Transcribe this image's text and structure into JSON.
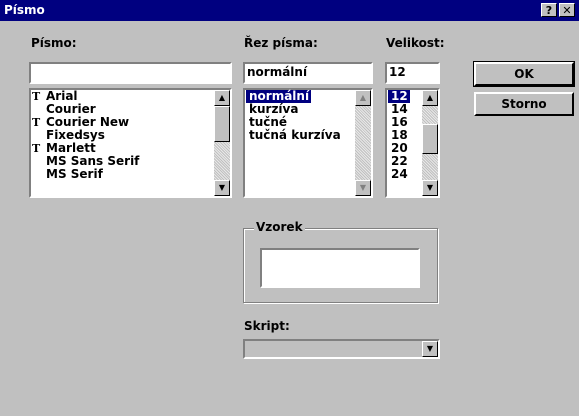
{
  "window": {
    "title": "Písmo",
    "help_label": "?",
    "close_label": "✕"
  },
  "font": {
    "label": "Písmo:",
    "value": "",
    "items": [
      {
        "name": "Arial",
        "truetype": true,
        "selected": false
      },
      {
        "name": "Courier",
        "truetype": false,
        "selected": false
      },
      {
        "name": "Courier New",
        "truetype": true,
        "selected": false
      },
      {
        "name": "Fixedsys",
        "truetype": false,
        "selected": false
      },
      {
        "name": "Marlett",
        "truetype": true,
        "selected": false
      },
      {
        "name": "MS Sans Serif",
        "truetype": false,
        "selected": false
      },
      {
        "name": "MS Serif",
        "truetype": false,
        "selected": false
      }
    ]
  },
  "style": {
    "label": "Řez písma:",
    "value": "normální",
    "items": [
      {
        "name": "normální",
        "selected": true
      },
      {
        "name": "kurzíva",
        "selected": false
      },
      {
        "name": "tučné",
        "selected": false
      },
      {
        "name": "tučná kurzíva",
        "selected": false
      }
    ]
  },
  "size": {
    "label": "Velikost:",
    "value": "12",
    "items": [
      {
        "name": "12",
        "selected": true
      },
      {
        "name": "14",
        "selected": false
      },
      {
        "name": "16",
        "selected": false
      },
      {
        "name": "18",
        "selected": false
      },
      {
        "name": "20",
        "selected": false
      },
      {
        "name": "22",
        "selected": false
      },
      {
        "name": "24",
        "selected": false
      }
    ]
  },
  "buttons": {
    "ok": "OK",
    "cancel": "Storno"
  },
  "sample": {
    "label": "Vzorek",
    "text": ""
  },
  "script": {
    "label": "Skript:",
    "value": ""
  },
  "icons": {
    "truetype": "TrueType-icon",
    "up_arrow": "▲",
    "down_arrow": "▼"
  },
  "colors": {
    "titlebar": "#000080",
    "face": "#c0c0c0",
    "selection": "#000080"
  }
}
